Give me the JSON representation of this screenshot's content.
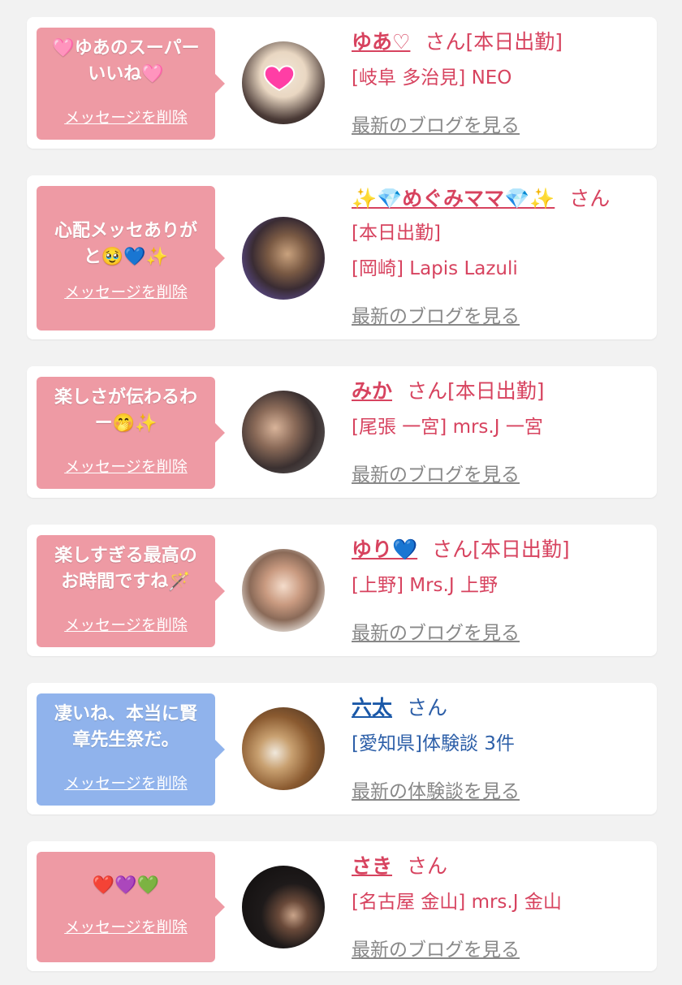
{
  "delete_label": "メッセージを削除",
  "cards": [
    {
      "message": "🩷ゆあのスーパー\nいいね🩷",
      "name": "ゆあ♡",
      "san": "さん",
      "status": "[本日出勤]",
      "shop": "[岐阜 多治見] NEO",
      "blog": "最新のブログを見る"
    },
    {
      "message": "心配メッセありが\nと🥹💙✨",
      "name": "✨💎めぐみママ💎✨",
      "san": "さん",
      "status": "[本日出勤]",
      "shop": "[岡崎] Lapis Lazuli",
      "blog": "最新のブログを見る"
    },
    {
      "message": "楽しさが伝わるわ\nー🤭✨",
      "name": "みか",
      "san": "さん",
      "status": "[本日出勤]",
      "shop": "[尾張 一宮] mrs.J 一宮",
      "blog": "最新のブログを見る"
    },
    {
      "message": "楽しすぎる最高の\nお時間ですね🪄",
      "name": "ゆり💙",
      "san": "さん",
      "status": "[本日出勤]",
      "shop": "[上野] Mrs.J 上野",
      "blog": "最新のブログを見る"
    },
    {
      "message": "凄いね、本当に賢\n章先生祭だ。",
      "name": "六太",
      "san": "さん",
      "status": "",
      "shop": "[愛知県]体験談 3件",
      "blog": "最新の体験談を見る"
    },
    {
      "message": "❤️💜💚",
      "name": "さき",
      "san": "さん",
      "status": "",
      "shop": "[名古屋 金山] mrs.J 金山",
      "blog": "最新のブログを見る"
    }
  ],
  "colors": {
    "bubble_pink": "#ee9aa4",
    "bubble_blue": "#90b3ec",
    "name_pink": "#d7435f",
    "name_blue": "#1a58a8",
    "link_gray": "#888888"
  }
}
